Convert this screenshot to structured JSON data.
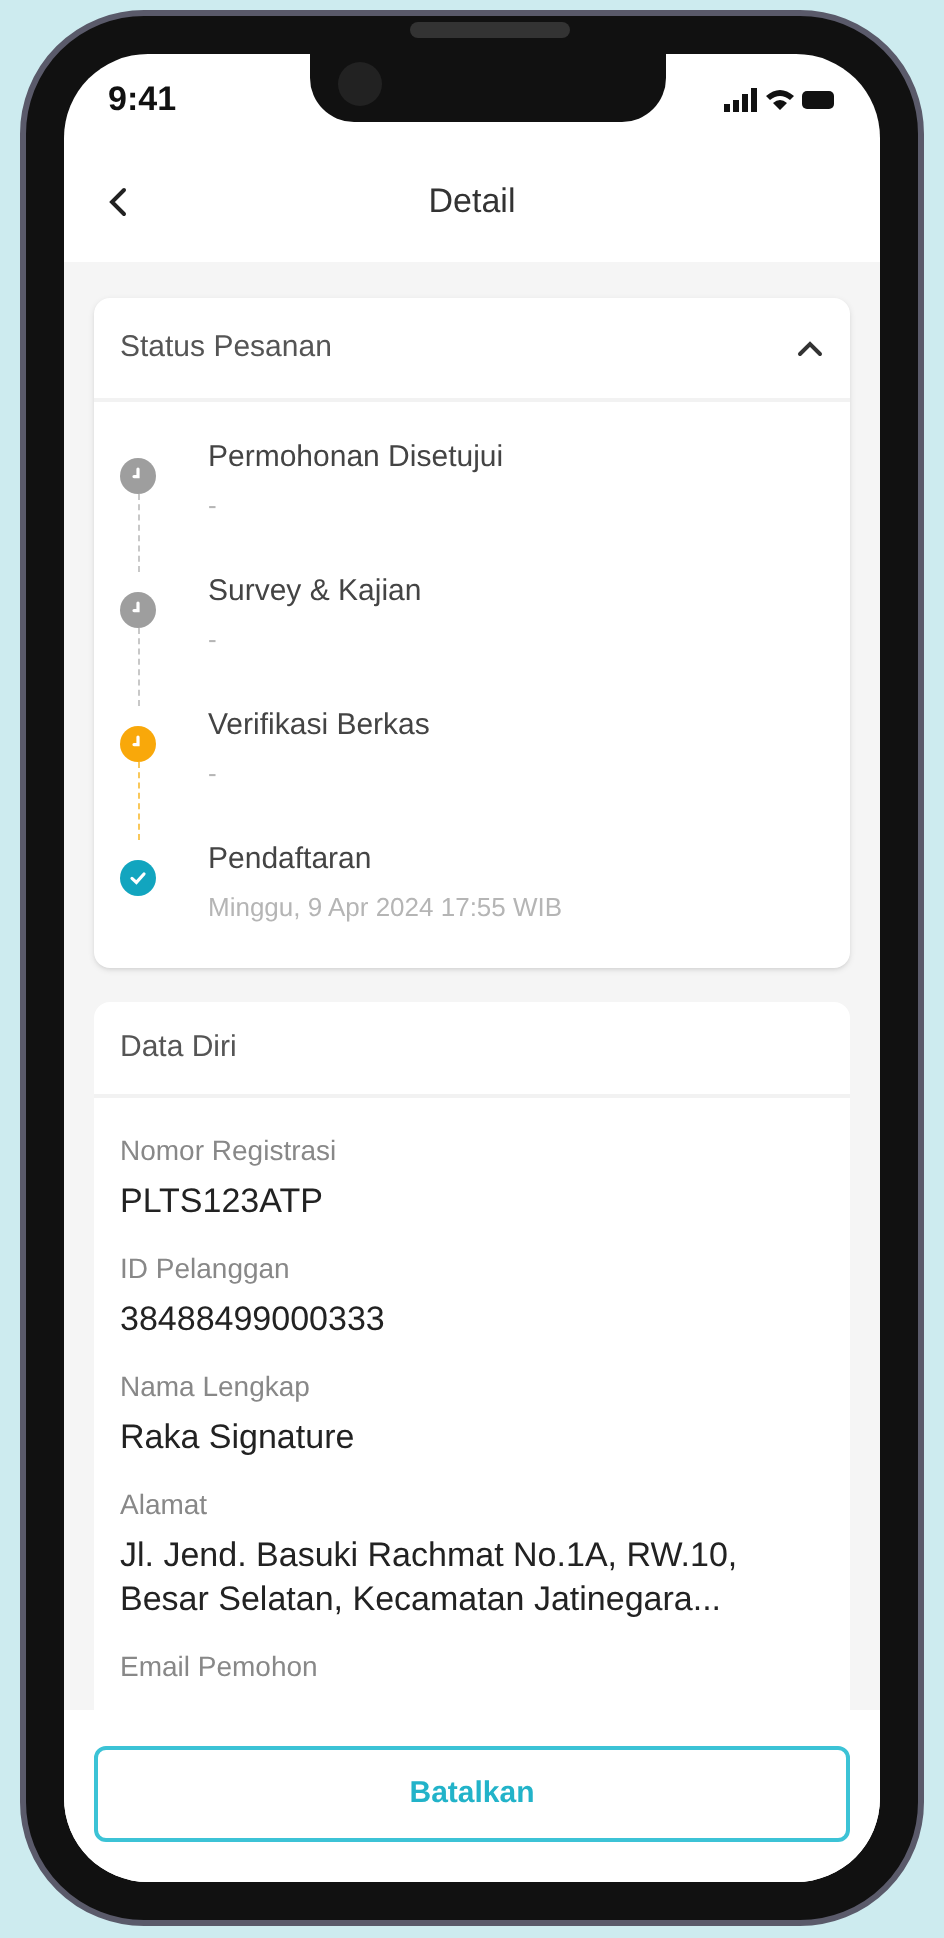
{
  "status_bar": {
    "time": "9:41"
  },
  "header": {
    "title": "Detail"
  },
  "status_card": {
    "title": "Status Pesanan",
    "expanded": true,
    "steps": [
      {
        "title": "Permohonan Disetujui",
        "subtitle": "-",
        "kind": "pending"
      },
      {
        "title": "Survey & Kajian",
        "subtitle": "-",
        "kind": "pending"
      },
      {
        "title": "Verifikasi Berkas",
        "subtitle": "-",
        "kind": "active"
      },
      {
        "title": "Pendaftaran",
        "subtitle": "Minggu, 9 Apr 2024 17:55 WIB",
        "kind": "done"
      }
    ]
  },
  "data_card": {
    "title": "Data Diri",
    "fields": [
      {
        "label": "Nomor Registrasi",
        "value": "PLTS123ATP"
      },
      {
        "label": "ID Pelanggan",
        "value": "38488499000333"
      },
      {
        "label": "Nama Lengkap",
        "value": "Raka Signature"
      },
      {
        "label": "Alamat",
        "value": "Jl. Jend. Basuki Rachmat No.1A, RW.10, Besar Selatan, Kecamatan Jatinegara..."
      },
      {
        "label": "Email Pemohon"
      }
    ]
  },
  "footer": {
    "button": "Batalkan"
  }
}
